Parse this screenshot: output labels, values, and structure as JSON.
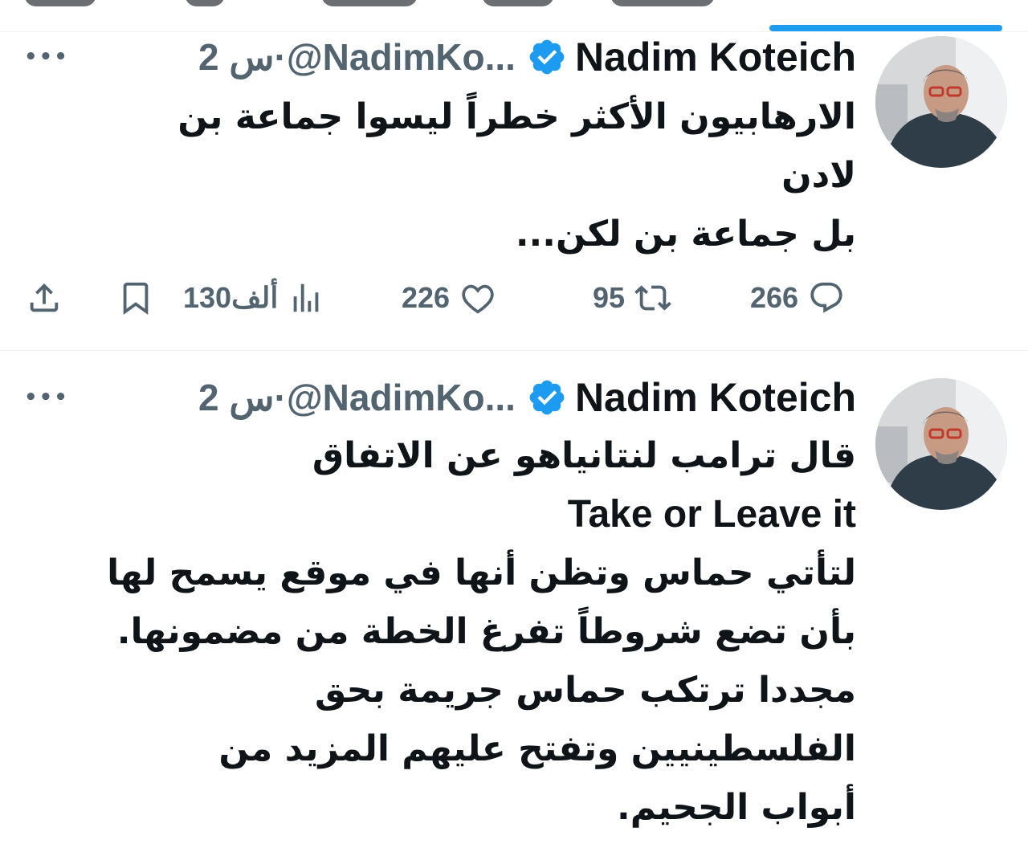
{
  "tweets": [
    {
      "author_name": "Nadim Koteich",
      "handle": "@NadimKo...",
      "separator": "·",
      "time": "2 س",
      "more_label": "•••",
      "lines": [
        "الارهابيون الأكثر خطراً ليسوا جماعة بن",
        "لادن",
        "بل جماعة بن لكن..."
      ],
      "replies": "266",
      "retweets": "95",
      "likes": "226",
      "views": "130ألف"
    },
    {
      "author_name": "Nadim Koteich",
      "handle": "@NadimKo...",
      "separator": "·",
      "time": "2 س",
      "more_label": "•••",
      "lines": [
        "قال ترامب لنتانياهو عن الاتفاق",
        "Take or Leave it",
        "لتأتي حماس وتظن أنها في موقع يسمح لها",
        "بأن تضع شروطاً تفرغ الخطة من مضمونها.",
        "مجددا ترتكب حماس جريمة بحق",
        "الفلسطينيين وتفتح عليهم المزيد من",
        "أبواب الجحيم."
      ]
    }
  ],
  "icons": {
    "verified": "verified-badge-icon",
    "reply": "reply-icon",
    "retweet": "retweet-icon",
    "like": "heart-icon",
    "views": "views-icon",
    "bookmark": "bookmark-icon",
    "share": "share-icon"
  },
  "colors": {
    "accent": "#1d9bf0",
    "text": "#0f1419",
    "muted": "#536471",
    "divider": "#eff3f4"
  }
}
